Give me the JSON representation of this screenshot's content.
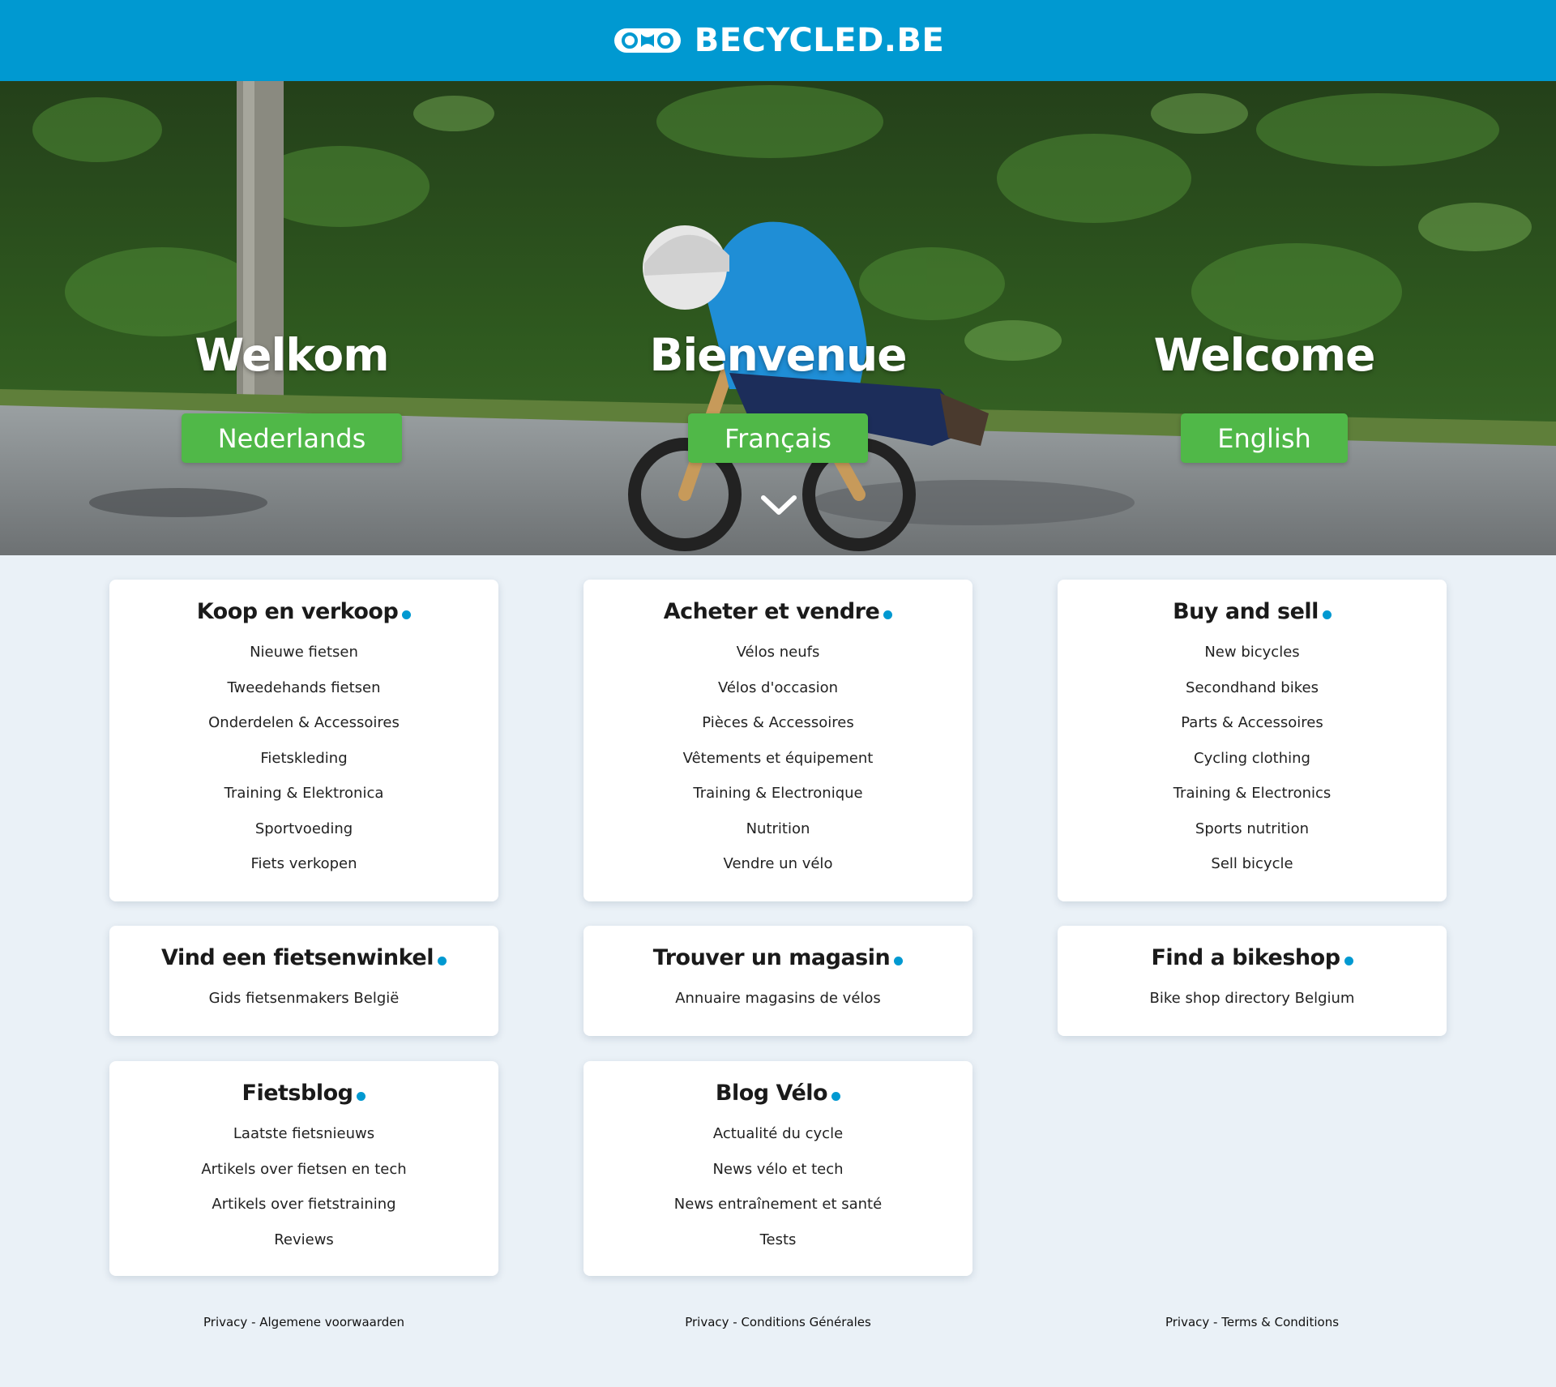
{
  "header": {
    "brand": "BECYCLED.BE",
    "logo_icon": "bike-chain-logo-icon",
    "background_color": "#0099d1"
  },
  "hero": {
    "columns": [
      {
        "title": "Welkom",
        "button": "Nederlands"
      },
      {
        "title": "Bienvenue",
        "button": "Français"
      },
      {
        "title": "Welcome",
        "button": "English"
      }
    ],
    "scroll_icon": "chevron-down-icon",
    "button_color": "#50b848"
  },
  "columns": [
    {
      "buy_sell": {
        "title": "Koop en verkoop",
        "items": [
          "Nieuwe fietsen",
          "Tweedehands fietsen",
          "Onderdelen & Accessoires",
          "Fietskleding",
          "Training & Elektronica",
          "Sportvoeding",
          "Fiets verkopen"
        ]
      },
      "shop": {
        "title": "Vind een fietsenwinkel",
        "items": [
          "Gids fietsenmakers België"
        ]
      },
      "blog": {
        "title": "Fietsblog",
        "items": [
          "Laatste fietsnieuws",
          "Artikels over fietsen en tech",
          "Artikels over fietstraining",
          "Reviews"
        ]
      },
      "footer": "Privacy - Algemene voorwaarden"
    },
    {
      "buy_sell": {
        "title": "Acheter et vendre",
        "items": [
          "Vélos neufs",
          "Vélos d'occasion",
          "Pièces & Accessoires",
          "Vêtements et équipement",
          "Training & Electronique",
          "Nutrition",
          "Vendre un vélo"
        ]
      },
      "shop": {
        "title": "Trouver un magasin",
        "items": [
          "Annuaire magasins de vélos"
        ]
      },
      "blog": {
        "title": "Blog Vélo",
        "items": [
          "Actualité du cycle",
          "News vélo et tech",
          "News entraînement et santé",
          "Tests"
        ]
      },
      "footer": "Privacy - Conditions Générales"
    },
    {
      "buy_sell": {
        "title": "Buy and sell",
        "items": [
          "New bicycles",
          "Secondhand bikes",
          "Parts & Accessoires",
          "Cycling clothing",
          "Training & Electronics",
          "Sports nutrition",
          "Sell bicycle"
        ]
      },
      "shop": {
        "title": "Find a bikeshop",
        "items": [
          "Bike shop directory Belgium"
        ]
      },
      "footer": "Privacy - Terms & Conditions"
    }
  ],
  "colors": {
    "accent_dot": "#0099d1",
    "page_background": "#eaf1f7"
  }
}
